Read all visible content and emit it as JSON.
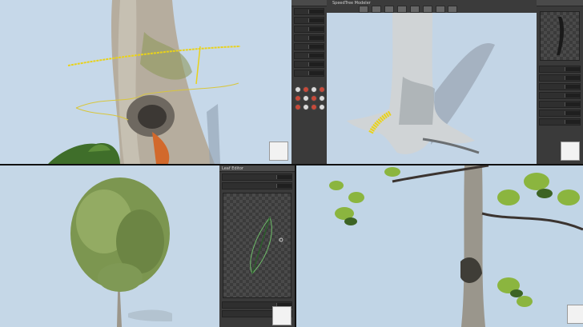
{
  "colors": {
    "sky": "#c3d6e8",
    "panel_dark": "#3a3a3a",
    "selection_yellow": "#e9d21a",
    "bark_grey": "#b9b3a8",
    "foliage": "#8aa35a",
    "knot_orange": "#d2692c"
  },
  "top_right": {
    "window_title": "SpeedTree Modeler",
    "toolbar_icons": [
      "cursor-icon",
      "move-icon",
      "rotate-icon",
      "scale-icon",
      "brush-icon",
      "knife-icon",
      "eye-icon",
      "gear-icon"
    ]
  },
  "center_panel": {
    "icon_rows": 6
  },
  "leaf_panel": {
    "header": "Leaf Editor"
  },
  "viewports": [
    {
      "name": "trunk-knot-closeup"
    },
    {
      "name": "root-flare-render"
    },
    {
      "name": "full-tree-preview"
    },
    {
      "name": "canopy-closeup"
    }
  ]
}
